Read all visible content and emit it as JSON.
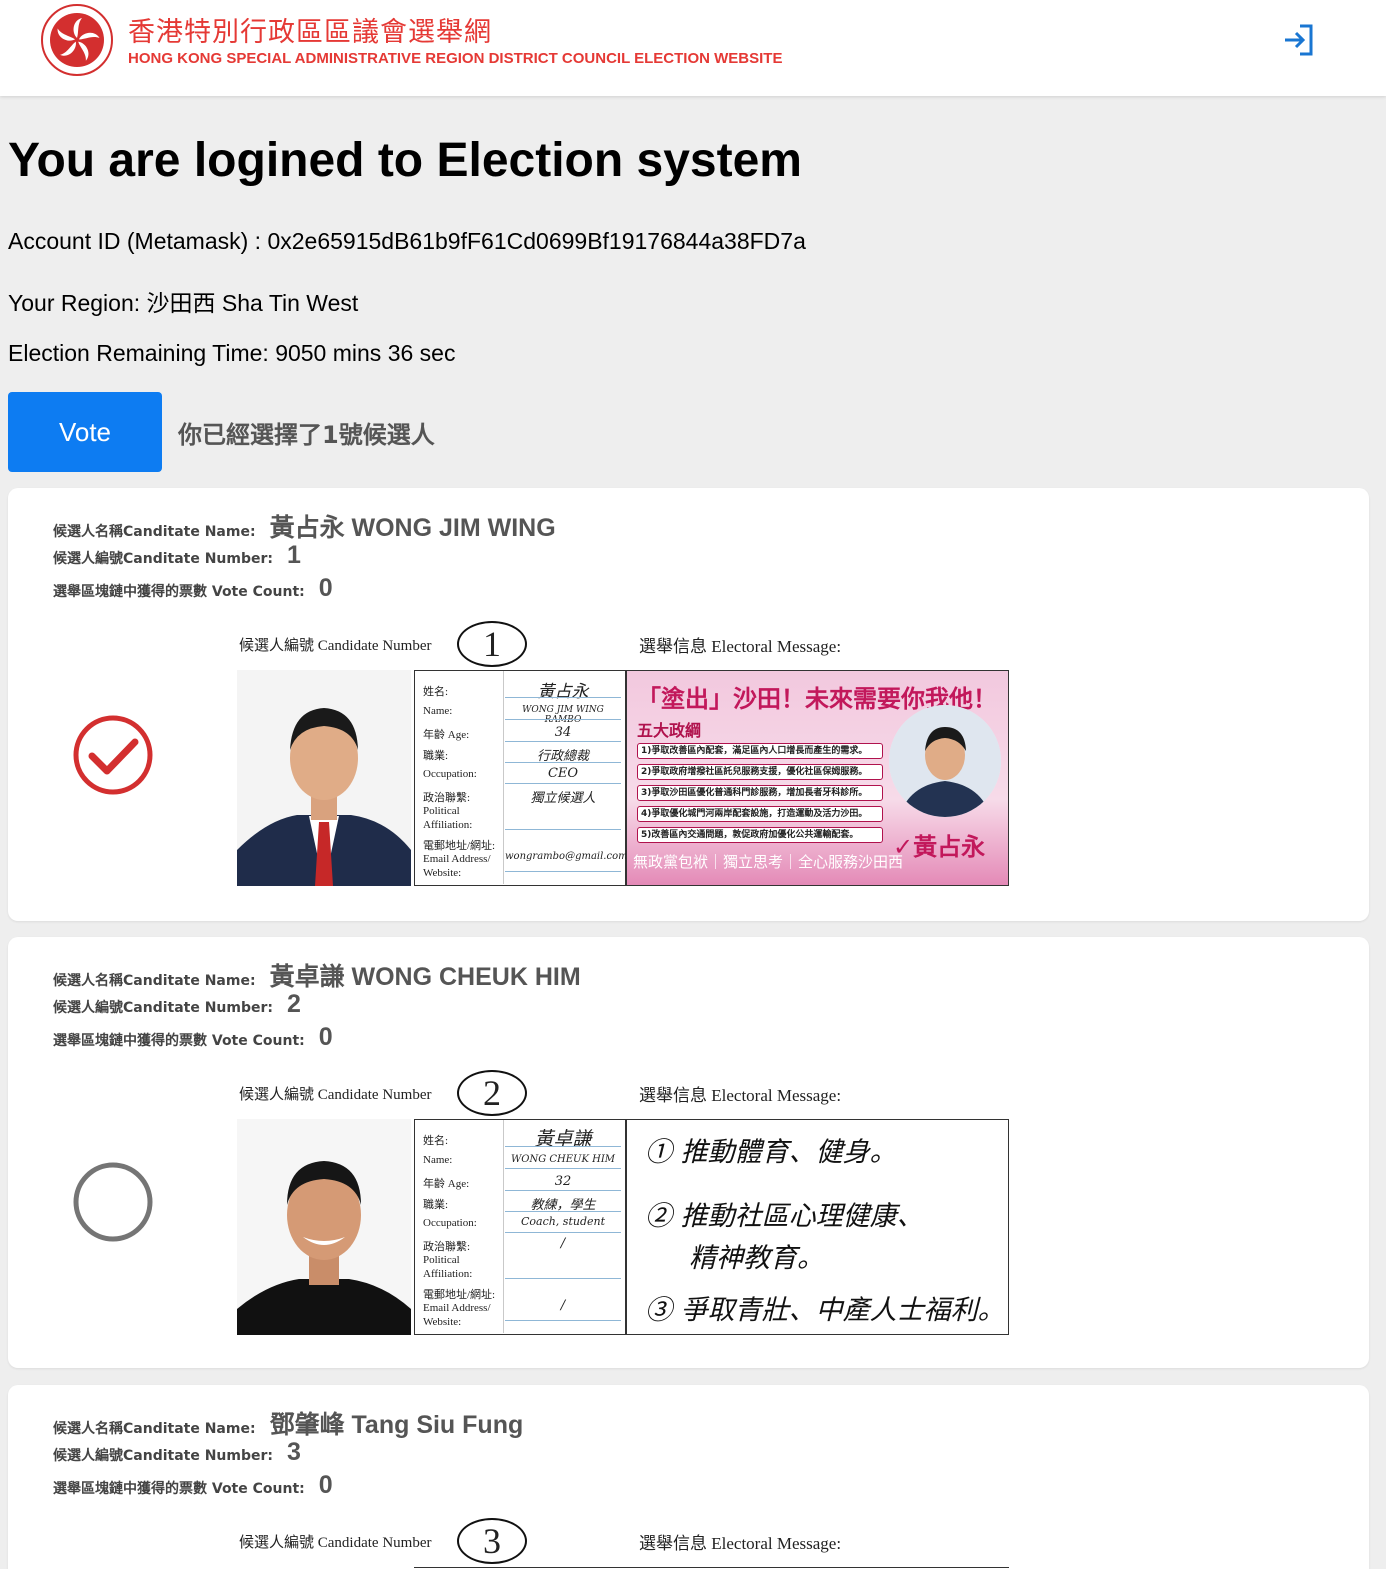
{
  "header": {
    "title_zh": "香港特別行政區區議會選舉網",
    "title_en": "HONG KONG SPECIAL ADMINISTRATIVE REGION DISTRICT COUNCIL ELECTION WEBSITE",
    "emblem_icon": "hksar-emblem-icon",
    "login_icon": "login-icon",
    "brand_color": "#e53935",
    "accent_color": "#1976d2"
  },
  "main": {
    "heading": "You are logined to Election system",
    "account_label": "Account ID (Metamask) : ",
    "account_id": "0x2e65915dB61b9fF61Cd0699Bf19176844a38FD7a",
    "region_label": "Your Region: ",
    "region": "沙田西 Sha Tin West",
    "time_label": "Election Remaining Time: ",
    "remaining_time": "9050 mins 36 sec",
    "vote_button": "Vote",
    "vote_button_color": "#0d7cf2",
    "selected_message": "你已經選擇了1號候選人"
  },
  "labels": {
    "name": "候選人名稱Canditate Name:",
    "number": "候選人編號Canditate Number:",
    "vote_count": "選舉區塊鏈中獲得的票數 Vote Count:",
    "ballot_number": "候選人編號  Candidate Number",
    "ballot_message": "選舉信息  Electoral Message:",
    "form_name_zh": "姓名:",
    "form_name_en": "Name:",
    "form_age": "年齡  Age:",
    "form_occ_zh": "職業:",
    "form_occ_en": "Occupation:",
    "form_pol_zh": "政治聯繫:",
    "form_pol_en1": "Political",
    "form_pol_en2": "Affiliation:",
    "form_email_zh": "電郵地址/網址:",
    "form_email_en1": "Email  Address/",
    "form_email_en2": "Website:"
  },
  "candidates": [
    {
      "name": "黃占永 WONG JIM WING",
      "number": "1",
      "vote_count": "0",
      "selected": true,
      "ballot_number": "1",
      "form": {
        "name_zh": "黃占永",
        "name_en": "WONG JIM WING RAMBO",
        "age": "34",
        "occupation_zh": "行政總裁",
        "occupation_en": "CEO",
        "affiliation": "獨立候選人",
        "email": "wongrambo@gmail.com"
      },
      "poster": {
        "title": "「塗出」沙田！未來需要你我他！",
        "subtitle": "五大政綱",
        "items": [
          "1)爭取改善區內配套，滿足區內人口增長而產生的需求。",
          "2)爭取政府增撥社區託兒服務支援，優化社區保姆服務。",
          "3)爭取沙田區優化普通科門診服務，增加長者牙科診所。",
          "4)爭取優化城門河兩岸配套設施，打造運動及活力沙田。",
          "5)改善區內交通問題，敦促政府加優化公共運輸配套。"
        ],
        "footer": "無政黨包袱｜獨立思考｜全心服務沙田西",
        "name": "✓黃占永"
      }
    },
    {
      "name": "黃卓謙 WONG CHEUK HIM",
      "number": "2",
      "vote_count": "0",
      "selected": false,
      "ballot_number": "2",
      "form": {
        "name_zh": "黃卓謙",
        "name_en": "WONG CHEUK HIM",
        "age": "32",
        "occupation_zh": "教練，學生",
        "occupation_en": "Coach, student",
        "affiliation": "/",
        "email": "/"
      },
      "message_lines": [
        "① 推動體育、健身。",
        "② 推動社區心理健康、",
        "精神教育。",
        "③ 爭取青壯、中產人士福利。"
      ]
    },
    {
      "name": "鄧肇峰 Tang Siu Fung",
      "number": "3",
      "vote_count": "0",
      "selected": false,
      "ballot_number": "3"
    }
  ]
}
